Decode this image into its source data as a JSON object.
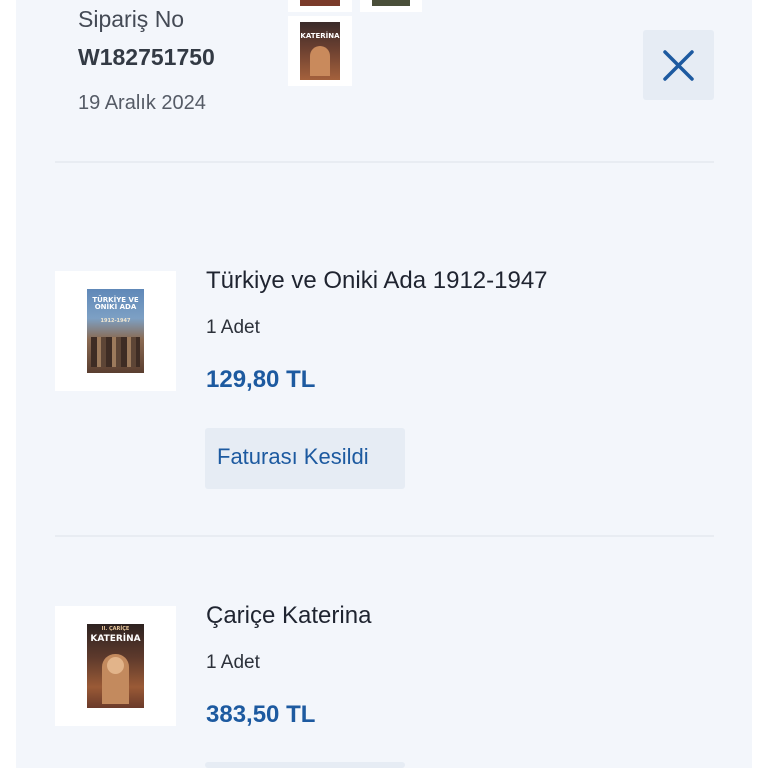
{
  "order": {
    "number_label": "Sipariş No",
    "number": "W182751750",
    "date": "19 Aralık 2024"
  },
  "close_icon": "close-icon",
  "products": [
    {
      "title": "Türkiye ve Oniki Ada 1912-1947",
      "quantity": "1 Adet",
      "price": "129,80 TL",
      "invoice_label": "Faturası Kesildi",
      "cover_text": "TÜRKİYE VE ONİKİ ADA",
      "cover_subtext": "1912-1947"
    },
    {
      "title": "Çariçe Katerina",
      "quantity": "1 Adet",
      "price": "383,50 TL",
      "cover_text": "KATERİNA",
      "cover_subtext": "II. ÇARİÇE"
    }
  ],
  "colors": {
    "panel_bg": "#f3f6fb",
    "accent": "#1d5aa0",
    "button_bg": "#e6ecf4"
  }
}
